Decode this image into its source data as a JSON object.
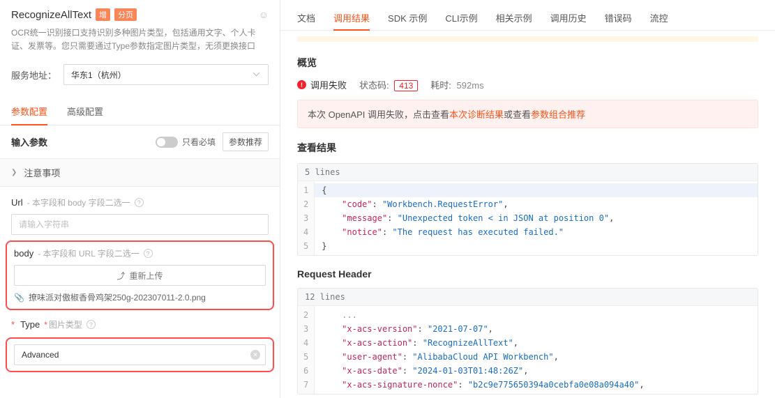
{
  "left": {
    "title": "RecognizeAllText",
    "tag1": "增",
    "tag2": "分页",
    "desc": "OCR统一识别接口支持识别多种图片类型，包括通用文字、个人卡证、发票等。您只需要通过Type参数指定图片类型，无须更换接口",
    "service_label": "服务地址：",
    "service_value": "华东1（杭州）",
    "tabs": {
      "param": "参数配置",
      "advanced": "高级配置"
    },
    "input_section_title": "输入参数",
    "only_required_label": "只看必填",
    "recommend_btn": "参数推荐",
    "notice_title": "注意事项",
    "url": {
      "label": "Url",
      "hint": "- 本字段和 body 字段二选一",
      "placeholder": "请输入字符串"
    },
    "body": {
      "label": "body",
      "hint": "- 本字段和 URL 字段二选一",
      "upload_btn": "重新上传",
      "filename": "撩味派对傲椒香骨鸡架250g-202307011-2.0.png"
    },
    "type": {
      "label": "Type",
      "hint": "图片类型",
      "value": "Advanced"
    }
  },
  "right": {
    "tabs": [
      "文档",
      "调用结果",
      "SDK 示例",
      "CLI示例",
      "相关示例",
      "调用历史",
      "错误码",
      "流控"
    ],
    "active_tab_index": 1,
    "overview_heading": "概览",
    "status": {
      "fail_text": "调用失败",
      "code_label": "状态码:",
      "code_value": "413",
      "time_label": "耗时:",
      "time_value": "592ms"
    },
    "alert": {
      "prefix": "本次 OpenAPI 调用失败，点击查看",
      "link1": "本次诊断结果",
      "mid": "或查看",
      "link2": "参数组合推荐"
    },
    "result_heading": "查看结果",
    "result_block": {
      "lines_label": "5 lines",
      "code": [
        {
          "n": 1,
          "t": "brace",
          "v": "{"
        },
        {
          "n": 2,
          "t": "kv",
          "k": "\"code\"",
          "v": "\"Workbench.RequestError\"",
          "comma": true
        },
        {
          "n": 3,
          "t": "kv",
          "k": "\"message\"",
          "v": "\"Unexpected token < in JSON at position 0\"",
          "comma": true
        },
        {
          "n": 4,
          "t": "kv",
          "k": "\"notice\"",
          "v": "\"The request has executed failed.\""
        },
        {
          "n": 5,
          "t": "brace",
          "v": "}"
        }
      ]
    },
    "header_heading": "Request Header",
    "header_block": {
      "lines_label": "12 lines",
      "code": [
        {
          "n": 2,
          "t": "truncated"
        },
        {
          "n": 3,
          "t": "kv",
          "k": "\"x-acs-version\"",
          "v": "\"2021-07-07\"",
          "comma": true
        },
        {
          "n": 4,
          "t": "kv",
          "k": "\"x-acs-action\"",
          "v": "\"RecognizeAllText\"",
          "comma": true
        },
        {
          "n": 5,
          "t": "kv",
          "k": "\"user-agent\"",
          "v": "\"AlibabaCloud API Workbench\"",
          "comma": true
        },
        {
          "n": 6,
          "t": "kv",
          "k": "\"x-acs-date\"",
          "v": "\"2024-01-03T01:48:26Z\"",
          "comma": true
        },
        {
          "n": 7,
          "t": "kv",
          "k": "\"x-acs-signature-nonce\"",
          "v": "\"b2c9e775650394a0cebfa0e08a094a40\"",
          "comma": true
        }
      ]
    }
  }
}
